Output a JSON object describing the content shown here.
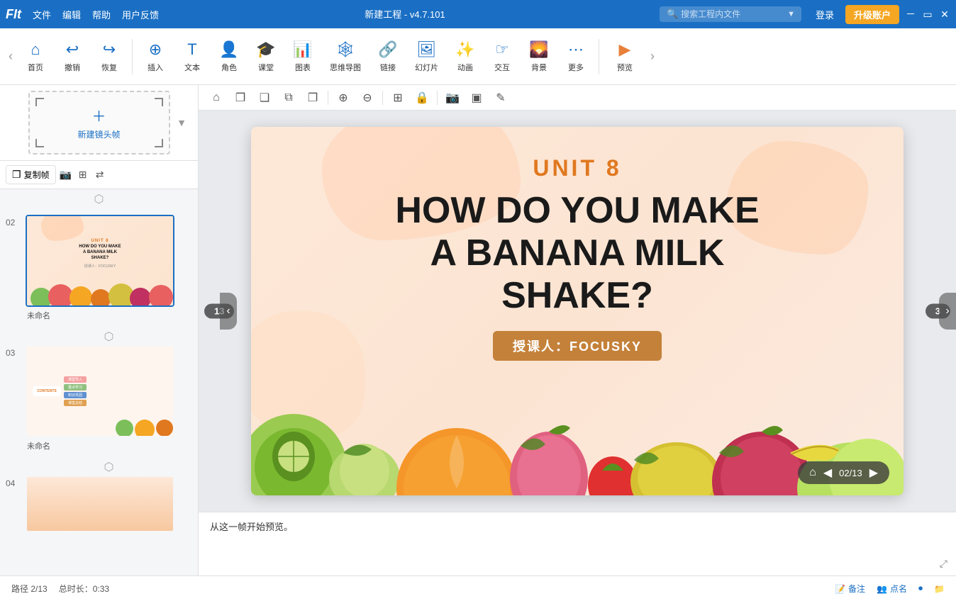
{
  "app": {
    "logo": "FIt",
    "title": "新建工程 - v4.7.101",
    "search_placeholder": "搜索工程内文件",
    "login_label": "登录",
    "upgrade_label": "升级账户"
  },
  "titlebar_menu": {
    "file": "文件",
    "edit": "编辑",
    "help": "帮助",
    "feedback": "用户反馈"
  },
  "toolbar": {
    "home": "首页",
    "undo": "撤销",
    "redo": "恢复",
    "insert": "插入",
    "text": "文本",
    "character": "角色",
    "classroom": "课堂",
    "chart": "图表",
    "mindmap": "思维导图",
    "link": "链接",
    "slideshow": "幻灯片",
    "animation": "动画",
    "interact": "交互",
    "background": "背景",
    "more": "更多",
    "preview": "预览"
  },
  "sidebar": {
    "new_frame_label": "新建镜头帧",
    "copy_frame": "复制帧",
    "slides": [
      {
        "number": "02",
        "label": "未命名",
        "active": true
      },
      {
        "number": "03",
        "label": "未命名",
        "active": false
      },
      {
        "number": "04",
        "label": "",
        "active": false
      }
    ]
  },
  "canvas": {
    "slide_counter_left": "13",
    "slide_counter_right": "3",
    "slide": {
      "unit": "UNIT 8",
      "title_line1": "HOW DO YOU MAKE",
      "title_line2": "A BANANA MILK",
      "title_line3": "SHAKE?",
      "author_label": "授课人：FOCUSKY"
    }
  },
  "playback": {
    "current": "02",
    "total": "13",
    "display": "02/13"
  },
  "notes": {
    "placeholder": "从这一帧开始预览。"
  },
  "statusbar": {
    "path": "路径 2/13",
    "duration": "总时长：0:33",
    "backup": "备注",
    "attendance": "点名"
  },
  "canvas_toolbar_icons": {
    "home": "⌂",
    "copy": "❒",
    "paste": "❑",
    "duplicate": "⧉",
    "zoom_in": "⊕",
    "zoom_out": "⊖",
    "align": "⊞",
    "lock": "🔒",
    "camera": "📷",
    "frame": "▣",
    "edit": "✎"
  }
}
